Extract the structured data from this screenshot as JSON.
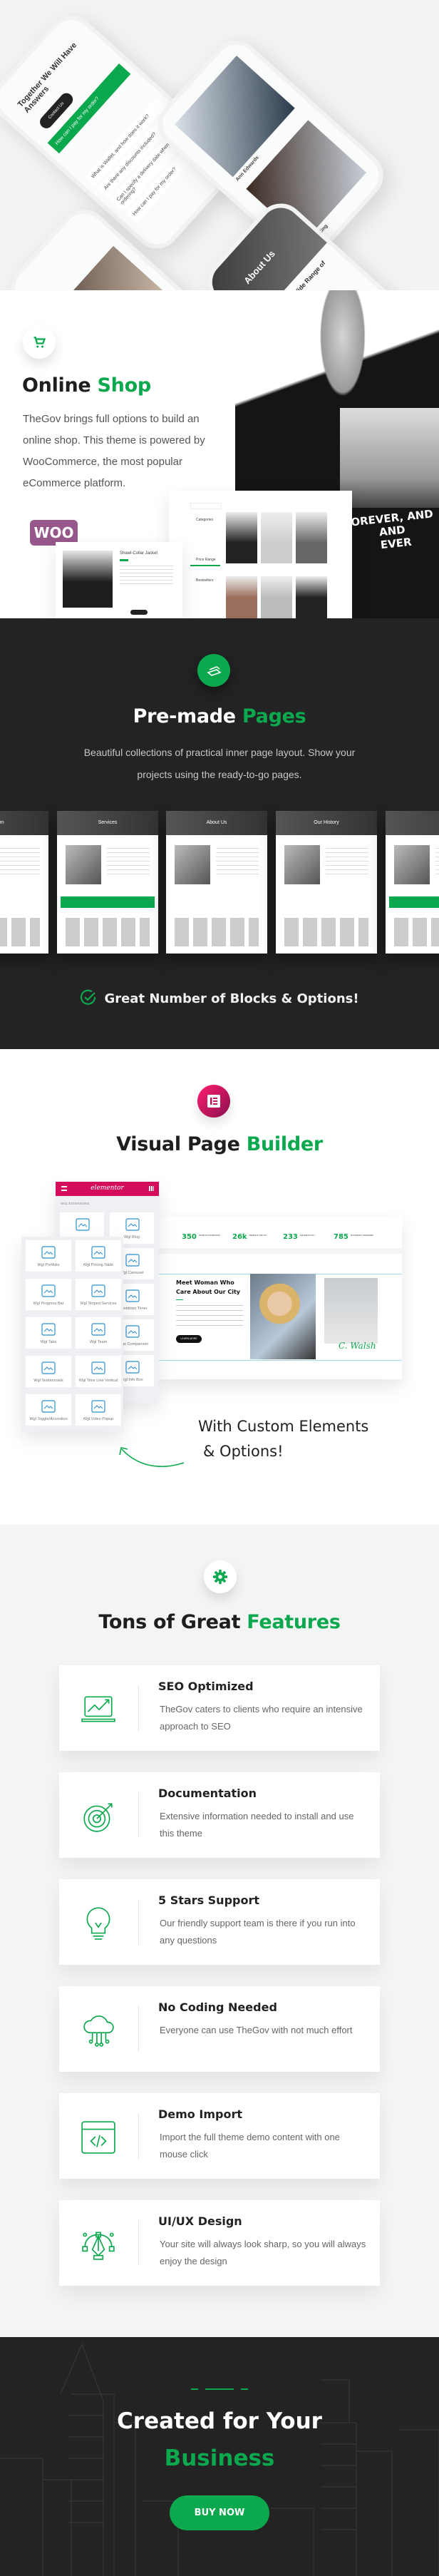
{
  "colors": {
    "accent": "#0ca84e",
    "dark": "#232323",
    "elementor": "#d30c5c"
  },
  "phones": {
    "faq_title": "Together We Will Have Answers",
    "contact_btn": "Contact Us",
    "faq_items": [
      "How can I pay for my order?",
      "What is Wallet, and how does it work?",
      "Are there any discounts included?",
      "Can I specify a delivery date when ordering?",
      "How can I pay for my order?"
    ],
    "team_names": [
      "Ann Edwards",
      "Eileen King"
    ],
    "about_title": "About Us",
    "about_heading": "We Provide a Wide Range of Practice Area"
  },
  "online_shop": {
    "icon": "cart-icon",
    "title_main": "Online",
    "title_accent": "Shop",
    "description": "TheGov brings full options to build an online shop. This theme is powered by WooCommerce, the most popular eCommerce platform.",
    "woo_logo": "WOO",
    "product_title": "Shawl-Collar Jacket",
    "shop_sidebar": [
      "Categories",
      "Price Range",
      "Bestsellers"
    ],
    "shirt_print": [
      "OREVER, AND",
      "AND EVER"
    ]
  },
  "premade": {
    "icon": "pages-icon",
    "title_main": "Pre-made",
    "title_accent": "Pages",
    "description": "Beautiful collections of practical inner page layout. Show your projects using the ready-to-go pages.",
    "screens": [
      "Team",
      "Services",
      "About Us",
      "Our History",
      ""
    ],
    "check_text": "Great Number of Blocks & Options!"
  },
  "builder": {
    "icon": "elementor-icon",
    "title_main": "Visual Page",
    "title_accent": "Builder",
    "panel_logo": "elementor",
    "panel_section": "WGL EXTENSIONS",
    "back_widgets": [
      "Wgl Blog",
      "Wgl Carousel",
      "Countdown Timer",
      "Image Comparison",
      "Wgl Info Box"
    ],
    "front_widgets": [
      "Wgl Portfolio",
      "Wgl Pricing Table",
      "Wgl Progress Bar",
      "Wgl Striped Services",
      "Wgl Tabs",
      "Wgl Team",
      "Wgl Testimonials",
      "Wgl Time Line Vertical",
      "Wgl Toggle/Accordion",
      "Wgl Video Popup"
    ],
    "stats": [
      {
        "value": "350",
        "label": "YEARS OF FOUNDATION"
      },
      {
        "value": "26k",
        "label": "PEOPLE IN THE CITY"
      },
      {
        "value": "233",
        "label": "SQUARE OF CITY"
      },
      {
        "value": "785",
        "label": "SUCCESSFUL PROGRAMS"
      }
    ],
    "preview_heading": "Meet Woman Who Care About Our City",
    "preview_button": "LEARN MORE",
    "signature": "C. Walsh",
    "tagline_1": "With Custom Elements",
    "tagline_2": "& Options!"
  },
  "features": {
    "icon": "gear-icon",
    "title_main": "Tons of Great",
    "title_accent": "Features",
    "items": [
      {
        "icon": "laptop-chart-icon",
        "title": "SEO Optimized",
        "desc": "TheGov caters to clients who require an intensive approach to SEO"
      },
      {
        "icon": "target-icon",
        "title": "Documentation",
        "desc": "Extensive information needed to install and use this theme"
      },
      {
        "icon": "lightbulb-icon",
        "title": "5 Stars Support",
        "desc": "Our friendly support team is there if  you run into any questions"
      },
      {
        "icon": "cloud-circuit-icon",
        "title": "No Coding Needed",
        "desc": "Everyone can use TheGov with not much effort"
      },
      {
        "icon": "code-window-icon",
        "title": "Demo Import",
        "desc": "Import the full theme demo content with one mouse click"
      },
      {
        "icon": "pen-tool-icon",
        "title": "UI/UX Design",
        "desc": "Your site will always look sharp, so you will always enjoy the design"
      }
    ]
  },
  "footer": {
    "title_1": "Created for Your",
    "title_2": "Business",
    "button": "BUY NOW"
  }
}
